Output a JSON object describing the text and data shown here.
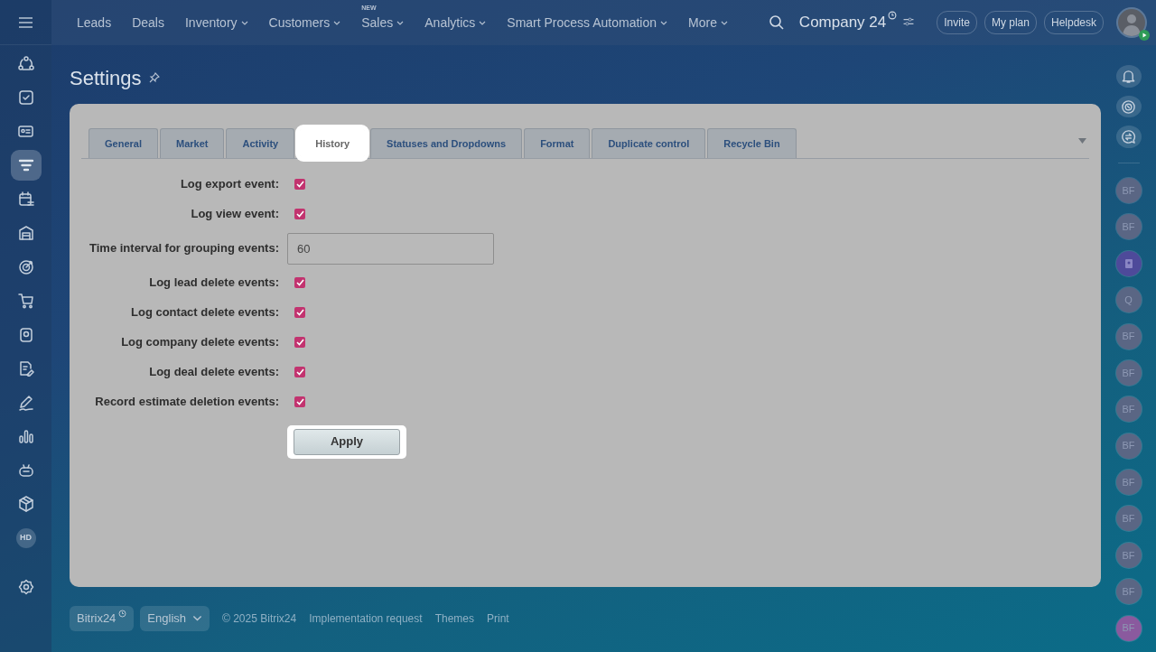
{
  "top_menu": {
    "items": [
      {
        "label": "Leads",
        "dropdown": false
      },
      {
        "label": "Deals",
        "dropdown": false
      },
      {
        "label": "Inventory",
        "dropdown": true
      },
      {
        "label": "Customers",
        "dropdown": true
      },
      {
        "label": "Sales",
        "badge": "NEW",
        "dropdown": true
      },
      {
        "label": "Analytics",
        "dropdown": true
      },
      {
        "label": "Smart Process Automation",
        "dropdown": true
      },
      {
        "label": "More",
        "dropdown": true
      }
    ]
  },
  "company": {
    "name": "Company 24"
  },
  "header_buttons": [
    "Invite",
    "My plan",
    "Helpdesk"
  ],
  "sidebar": {
    "items": [
      {
        "kind": "nodes",
        "selected": false
      },
      {
        "kind": "task",
        "selected": false
      },
      {
        "kind": "card",
        "selected": false
      },
      {
        "kind": "funnel",
        "selected": true
      },
      {
        "kind": "calendar",
        "selected": false
      },
      {
        "kind": "garage",
        "selected": false
      },
      {
        "kind": "target",
        "selected": false
      },
      {
        "kind": "cart",
        "selected": false
      },
      {
        "kind": "device",
        "selected": false
      },
      {
        "kind": "document",
        "selected": false
      },
      {
        "kind": "pen",
        "selected": false
      },
      {
        "kind": "bars",
        "selected": false
      },
      {
        "kind": "robot",
        "selected": false
      },
      {
        "kind": "box",
        "selected": false
      },
      {
        "kind": "text",
        "label": "HD",
        "selected": false
      },
      {
        "kind": "gear",
        "selected": false
      }
    ]
  },
  "right_rail": {
    "tools": [
      {
        "kind": "bell"
      },
      {
        "kind": "spiral"
      },
      {
        "kind": "chat"
      }
    ],
    "contacts": [
      {
        "kind": "text",
        "label": "BF",
        "color": "#5a6684"
      },
      {
        "kind": "text",
        "label": "BF",
        "color": "#5a6684"
      },
      {
        "kind": "contact",
        "color": "#4e4a9a"
      },
      {
        "kind": "text",
        "label": "Q",
        "color": "#5a6684"
      },
      {
        "kind": "text",
        "label": "BF",
        "color": "#5a6684"
      },
      {
        "kind": "text",
        "label": "BF",
        "color": "#5a6684"
      },
      {
        "kind": "text",
        "label": "BF",
        "color": "#5a6684"
      },
      {
        "kind": "text",
        "label": "BF",
        "color": "#5a6684"
      },
      {
        "kind": "text",
        "label": "BF",
        "color": "#5a6684"
      },
      {
        "kind": "text",
        "label": "BF",
        "color": "#5a6684"
      },
      {
        "kind": "text",
        "label": "BF",
        "color": "#5a6684"
      },
      {
        "kind": "text",
        "label": "BF",
        "color": "#5a6684"
      },
      {
        "kind": "text",
        "label": "BF",
        "color": "#8a5a9e"
      }
    ]
  },
  "page": {
    "title": "Settings"
  },
  "tabs": [
    {
      "label": "General",
      "selected": false
    },
    {
      "label": "Market",
      "selected": false
    },
    {
      "label": "Activity",
      "selected": false
    },
    {
      "label": "History",
      "selected": true
    },
    {
      "label": "Statuses and Dropdowns",
      "selected": false
    },
    {
      "label": "Format",
      "selected": false
    },
    {
      "label": "Duplicate control",
      "selected": false
    },
    {
      "label": "Recycle Bin",
      "selected": false
    }
  ],
  "form": {
    "rows": [
      {
        "kind": "checkbox",
        "label": "Log export event:",
        "checked": true
      },
      {
        "kind": "checkbox",
        "label": "Log view event:",
        "checked": true
      },
      {
        "kind": "input",
        "label": "Time interval for grouping events:",
        "value": "60"
      },
      {
        "kind": "checkbox",
        "label": "Log lead delete events:",
        "checked": true
      },
      {
        "kind": "checkbox",
        "label": "Log contact delete events:",
        "checked": true
      },
      {
        "kind": "checkbox",
        "label": "Log company delete events:",
        "checked": true
      },
      {
        "kind": "checkbox",
        "label": "Log deal delete events:",
        "checked": true
      },
      {
        "kind": "checkbox",
        "label": "Record estimate deletion events:",
        "checked": true
      }
    ],
    "apply_button": "Apply"
  },
  "footer": {
    "brand": "Bitrix24",
    "language": "English",
    "copyright": "© 2025 Bitrix24",
    "links": [
      "Implementation request",
      "Themes",
      "Print"
    ]
  }
}
